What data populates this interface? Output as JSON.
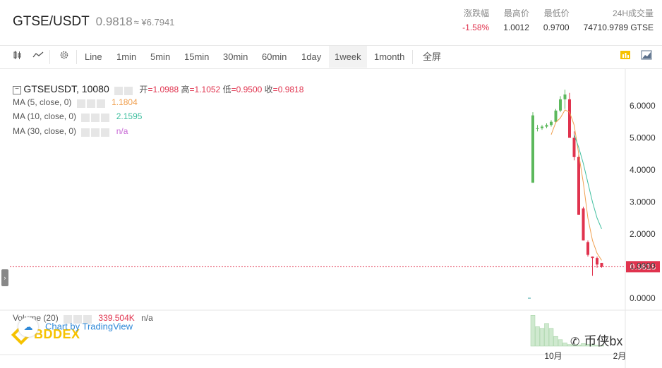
{
  "header": {
    "pair": "GTSE/USDT",
    "last_price": "0.9818",
    "cny_price": "≈ ¥6.7941",
    "stats": [
      {
        "label": "涨跌幅",
        "value": "-1.58%",
        "negative": true
      },
      {
        "label": "最高价",
        "value": "1.0012",
        "negative": false
      },
      {
        "label": "最低价",
        "value": "0.9700",
        "negative": false
      },
      {
        "label": "24H成交量",
        "value": "74710.9789 GTSE",
        "negative": false
      }
    ]
  },
  "toolbar": {
    "intervals": [
      "Line",
      "1min",
      "5min",
      "15min",
      "30min",
      "60min",
      "1day",
      "1week",
      "1month"
    ],
    "active": "1week",
    "fullscreen": "全屏"
  },
  "chart": {
    "symbol": "GTSEUSDT, 10080",
    "ohlc": {
      "open_label": "开",
      "open": "1.0988",
      "high_label": "高",
      "high": "1.1052",
      "low_label": "低",
      "low": "0.9500",
      "close_label": "收",
      "close": "0.9818"
    },
    "ma": [
      {
        "label": "MA (5, close, 0)",
        "value": "1.1804",
        "color": "#f0a050"
      },
      {
        "label": "MA (10, close, 0)",
        "value": "2.1595",
        "color": "#3fbf9f"
      },
      {
        "label": "MA (30, close, 0)",
        "value": "n/a",
        "color": "#c86ad6"
      }
    ],
    "price_axis": [
      "6.0000",
      "5.0000",
      "4.0000",
      "3.0000",
      "2.0000",
      "1.0000",
      "0.0000"
    ],
    "current_price": "0.9818",
    "time_axis": [
      "10月",
      "2月"
    ],
    "volume_label": "Volume (20)",
    "volume_value": "339.504K",
    "volume_na": "n/a",
    "brand_logo": "BDDEX",
    "tv_credit": "Chart by TradingView",
    "watermark": "币侠bx",
    "colors": {
      "up": "#5cb85c",
      "down": "#e0334e",
      "accent": "#f6c200"
    }
  },
  "chart_data": {
    "type": "candlestick",
    "ylim": [
      0,
      6.5
    ],
    "candles": [
      {
        "open": 3.6,
        "high": 5.8,
        "low": 3.6,
        "close": 5.7
      },
      {
        "open": 5.3,
        "high": 5.4,
        "low": 5.2,
        "close": 5.3
      },
      {
        "open": 5.3,
        "high": 5.4,
        "low": 5.25,
        "close": 5.35
      },
      {
        "open": 5.35,
        "high": 5.45,
        "low": 5.3,
        "close": 5.4
      },
      {
        "open": 5.4,
        "high": 5.55,
        "low": 5.35,
        "close": 5.5
      },
      {
        "open": 5.5,
        "high": 5.9,
        "low": 5.45,
        "close": 5.85
      },
      {
        "open": 5.85,
        "high": 6.3,
        "low": 5.8,
        "close": 6.2
      },
      {
        "open": 6.2,
        "high": 6.5,
        "low": 5.9,
        "close": 6.35
      },
      {
        "open": 6.2,
        "high": 6.4,
        "low": 5.0,
        "close": 5.0
      },
      {
        "open": 5.0,
        "high": 5.2,
        "low": 4.3,
        "close": 4.4
      },
      {
        "open": 4.4,
        "high": 4.5,
        "low": 2.6,
        "close": 2.6
      },
      {
        "open": 2.8,
        "high": 2.85,
        "low": 1.8,
        "close": 1.8
      },
      {
        "open": 1.75,
        "high": 1.8,
        "low": 1.3,
        "close": 1.35
      },
      {
        "open": 1.3,
        "high": 1.3,
        "low": 0.7,
        "close": 1.25
      },
      {
        "open": 1.25,
        "high": 1.3,
        "low": 0.95,
        "close": 1.05
      },
      {
        "open": 1.1,
        "high": 1.1,
        "low": 0.95,
        "close": 0.9818
      }
    ],
    "ma5": [
      null,
      null,
      null,
      null,
      5.1,
      5.48,
      5.62,
      5.87,
      5.8,
      5.4,
      4.5,
      3.6,
      2.5,
      1.8,
      1.4,
      1.1804
    ],
    "ma10": [
      null,
      null,
      null,
      null,
      null,
      null,
      null,
      null,
      null,
      5.1,
      4.7,
      4.2,
      3.6,
      3.0,
      2.5,
      2.1595
    ]
  }
}
